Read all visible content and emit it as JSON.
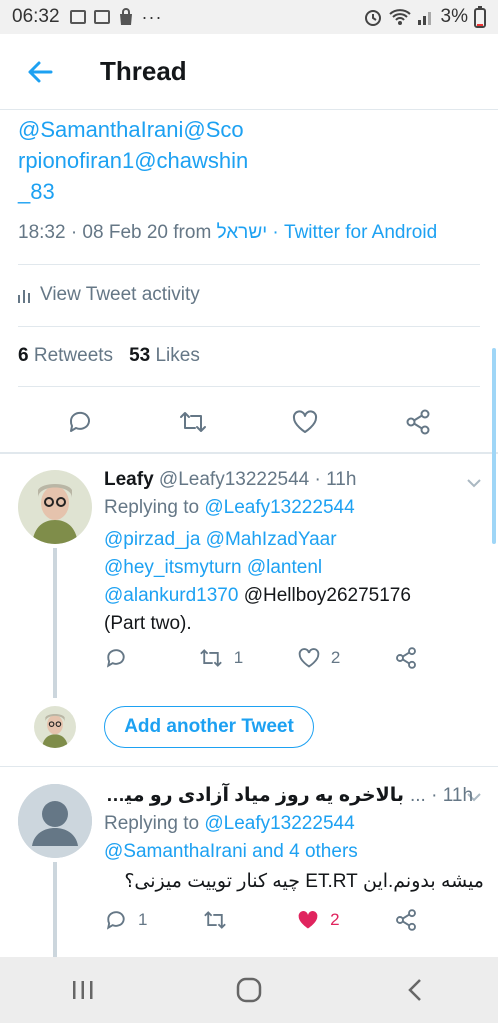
{
  "status_bar": {
    "time": "06:32",
    "battery": "3%",
    "more": "···"
  },
  "header": {
    "title": "Thread"
  },
  "main_tweet": {
    "text_lines": [
      "@SamanthaIrani@Sco",
      "rpionofiran1@chawshin",
      "_83"
    ],
    "time": "18:32 · 08 Feb 20 from ",
    "location": "ישראל",
    "source": " · Twitter for Android",
    "activity_label": "View Tweet activity",
    "retweets_count": "6",
    "retweets_label": "Retweets",
    "likes_count": "53",
    "likes_label": "Likes"
  },
  "replies": [
    {
      "name": "Leafy",
      "handle_time": "@Leafy13222544 · 11h",
      "replying_prefix": "Replying to ",
      "replying_to": "@Leafy13222544",
      "lines": [
        {
          "blue": "@pirzad_ja @MahIzadYaar",
          "plain": ""
        },
        {
          "blue": "@hey_itsmyturn @lantenl",
          "plain": ""
        },
        {
          "blue": "@alankurd1370",
          "plain": " @Hellboy26275176"
        },
        {
          "blue": "",
          "plain": "(Part two)."
        }
      ],
      "retweet_count": "1",
      "like_count": "2"
    },
    {
      "name": "بالاخره یه روز میاد آزادی رو میگم.",
      "handle_time": "... · 11h",
      "replying_prefix": "Replying to ",
      "replying_to": "@Leafy13222544",
      "replying_more": "@SamanthaIrani and 4 others",
      "text": "میشه بدونم.این ET.RT چیه کنار توییت میزنی؟",
      "reply_count": "1",
      "like_count": "2"
    }
  ],
  "add_tweet_label": "Add another Tweet",
  "colors": {
    "accent": "#1da1f2",
    "like_active": "#e0245e",
    "muted": "#657786"
  }
}
